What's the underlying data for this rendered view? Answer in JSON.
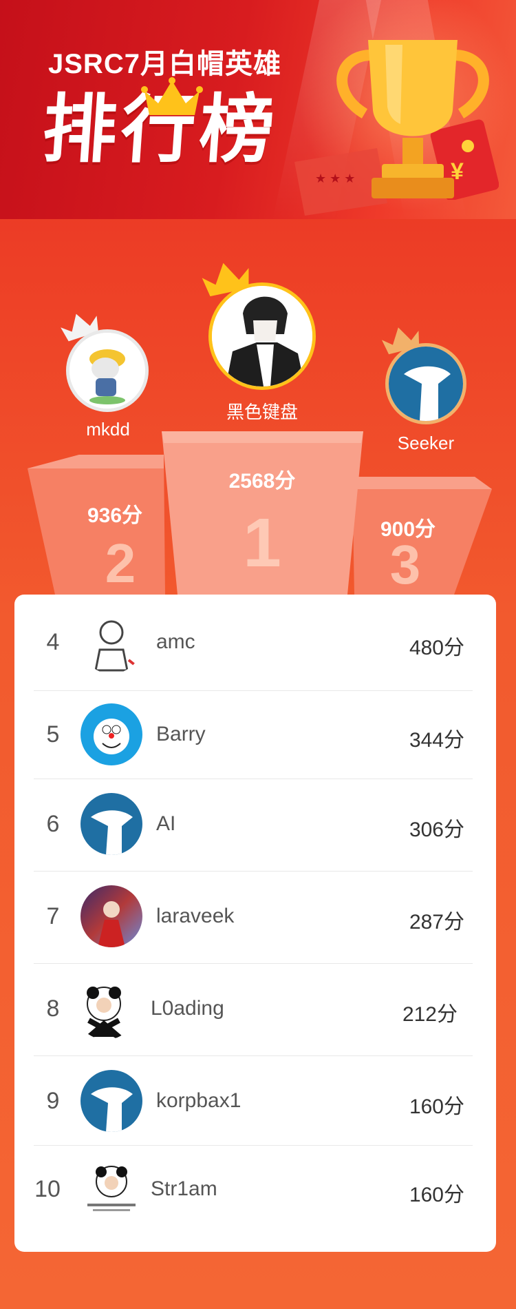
{
  "header": {
    "subtitle": "JSRC7月白帽英雄",
    "title": "排行榜"
  },
  "colors": {
    "header_red": "#d81c1f",
    "background_orange": "#f25a2e",
    "gold": "#ffc21a",
    "podium": "#f8a48a"
  },
  "podium": {
    "first": {
      "rank": "1",
      "name": "黑色键盘",
      "score": "2568分",
      "avatar_icon": "anime-boy-avatar"
    },
    "second": {
      "rank": "2",
      "name": "mkdd",
      "score": "936分",
      "avatar_icon": "cartoon-dog-avatar"
    },
    "third": {
      "rank": "3",
      "name": "Seeker",
      "score": "900分",
      "avatar_icon": "default-blue-avatar"
    }
  },
  "ranking": [
    {
      "rank": "4",
      "name": "amc",
      "score": "480分",
      "avatar_icon": "sketch-man-avatar"
    },
    {
      "rank": "5",
      "name": "Barry",
      "score": "344分",
      "avatar_icon": "doraemon-avatar"
    },
    {
      "rank": "6",
      "name": "AI",
      "score": "306分",
      "avatar_icon": "default-blue-avatar"
    },
    {
      "rank": "7",
      "name": "laraveek",
      "score": "287分",
      "avatar_icon": "anime-warrior-avatar"
    },
    {
      "rank": "8",
      "name": "L0ading",
      "score": "212分",
      "avatar_icon": "panda-meme-avatar"
    },
    {
      "rank": "9",
      "name": "korpbax1",
      "score": "160分",
      "avatar_icon": "default-blue-avatar"
    },
    {
      "rank": "10",
      "name": "Str1am",
      "score": "160分",
      "avatar_icon": "panda-meme-avatar"
    }
  ]
}
